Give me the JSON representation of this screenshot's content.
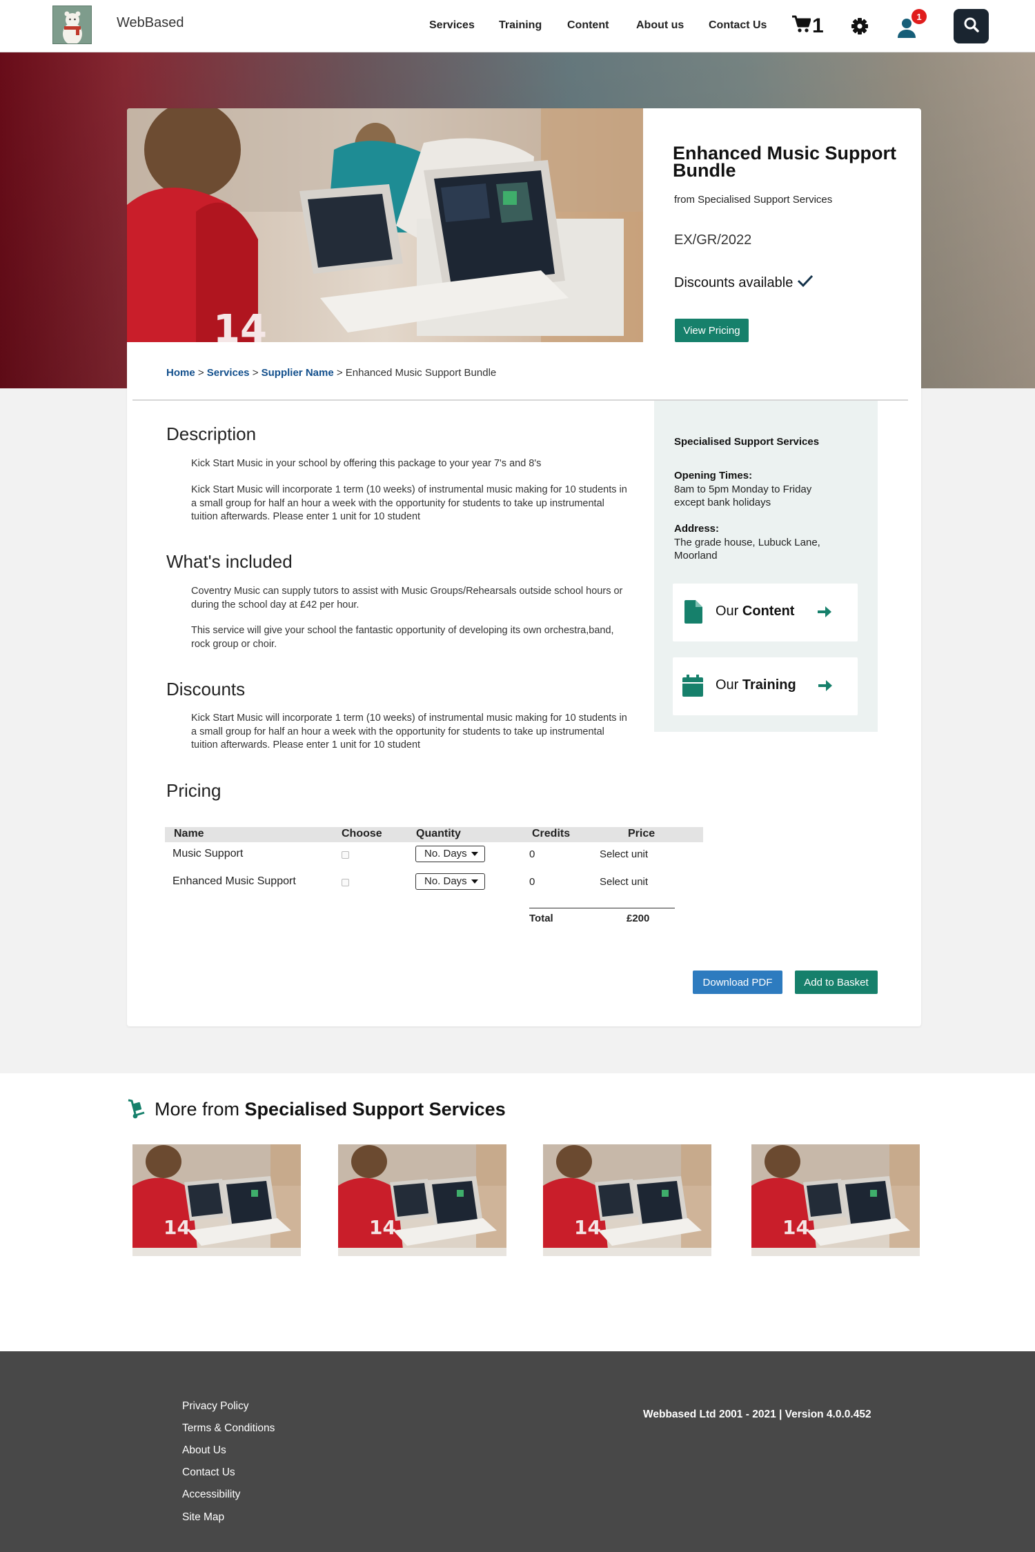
{
  "header": {
    "brand": "WebBased",
    "nav": [
      "Services",
      "Training",
      "Content",
      "About us",
      "Contact Us"
    ],
    "cart_count": "1",
    "notification_count": "1"
  },
  "product": {
    "title": "Enhanced Music Support Bundle",
    "from": "from Specialised Support Services",
    "code": "EX/GR/2022",
    "discounts": "Discounts available",
    "view_pricing": "View Pricing"
  },
  "breadcrumb": {
    "home": "Home",
    "sep": ">",
    "services": "Services",
    "supplier": "Supplier Name",
    "current": "Enhanced Music Support Bundle"
  },
  "description": {
    "heading": "Description",
    "p1": "Kick Start Music in your school by offering this package to your year 7's and 8's",
    "p2": "Kick Start Music will incorporate 1 term (10 weeks) of instrumental music making for 10 students in a small group for half an hour a week with the opportunity for students to take up instrumental tuition afterwards.  Please enter 1 unit for 10 student"
  },
  "included": {
    "heading": "What's included",
    "p1": "Coventry Music can supply tutors to assist with Music Groups/Rehearsals outside school hours or during the school day at £42 per hour.",
    "p2": "This service will give your school the fantastic opportunity of developing its own orchestra,band, rock group or choir."
  },
  "discounts": {
    "heading": "Discounts",
    "p1": "Kick Start Music will incorporate 1 term (10 weeks) of instrumental music making for 10 students in a small group for half an hour a week with the opportunity for students to take up instrumental tuition afterwards.  Please enter 1 unit for 10 student"
  },
  "sidebar": {
    "title": "Specialised Support Services",
    "opening_label": "Opening Times:",
    "opening_text": "8am to 5pm Monday to Friday except bank holidays",
    "address_label": "Address:",
    "address_text": "The grade house, Lubuck Lane, Moorland",
    "content_prefix": "Our",
    "content_bold": "Content",
    "training_prefix": "Our",
    "training_bold": "Training"
  },
  "pricing": {
    "heading": "Pricing",
    "columns": [
      "Name",
      "Choose",
      "Quantity",
      "Credits",
      "Price"
    ],
    "rows": [
      {
        "name": "Music Support",
        "quantity": "No. Days",
        "credits": "0",
        "price": "Select unit"
      },
      {
        "name": "Enhanced Music Support",
        "quantity": "No. Days",
        "credits": "0",
        "price": "Select unit"
      }
    ],
    "total_label": "Total",
    "total_value": "£200",
    "download_pdf": "Download PDF",
    "add_to_basket": "Add to Basket"
  },
  "more": {
    "prefix": "More from",
    "supplier": "Specialised Support Services"
  },
  "footer": {
    "links": [
      "Privacy Policy",
      "Terms & Conditions",
      "About Us",
      "Contact Us",
      "Accessibility",
      "Site Map"
    ],
    "copyright": "Webbased Ltd 2001 - 2021 | Version 4.0.0.452"
  },
  "colors": {
    "accent": "#16806b",
    "link": "#124f8c",
    "blue_button": "#2d7bbf",
    "footer": "#484848",
    "badge": "#e01d1d"
  }
}
